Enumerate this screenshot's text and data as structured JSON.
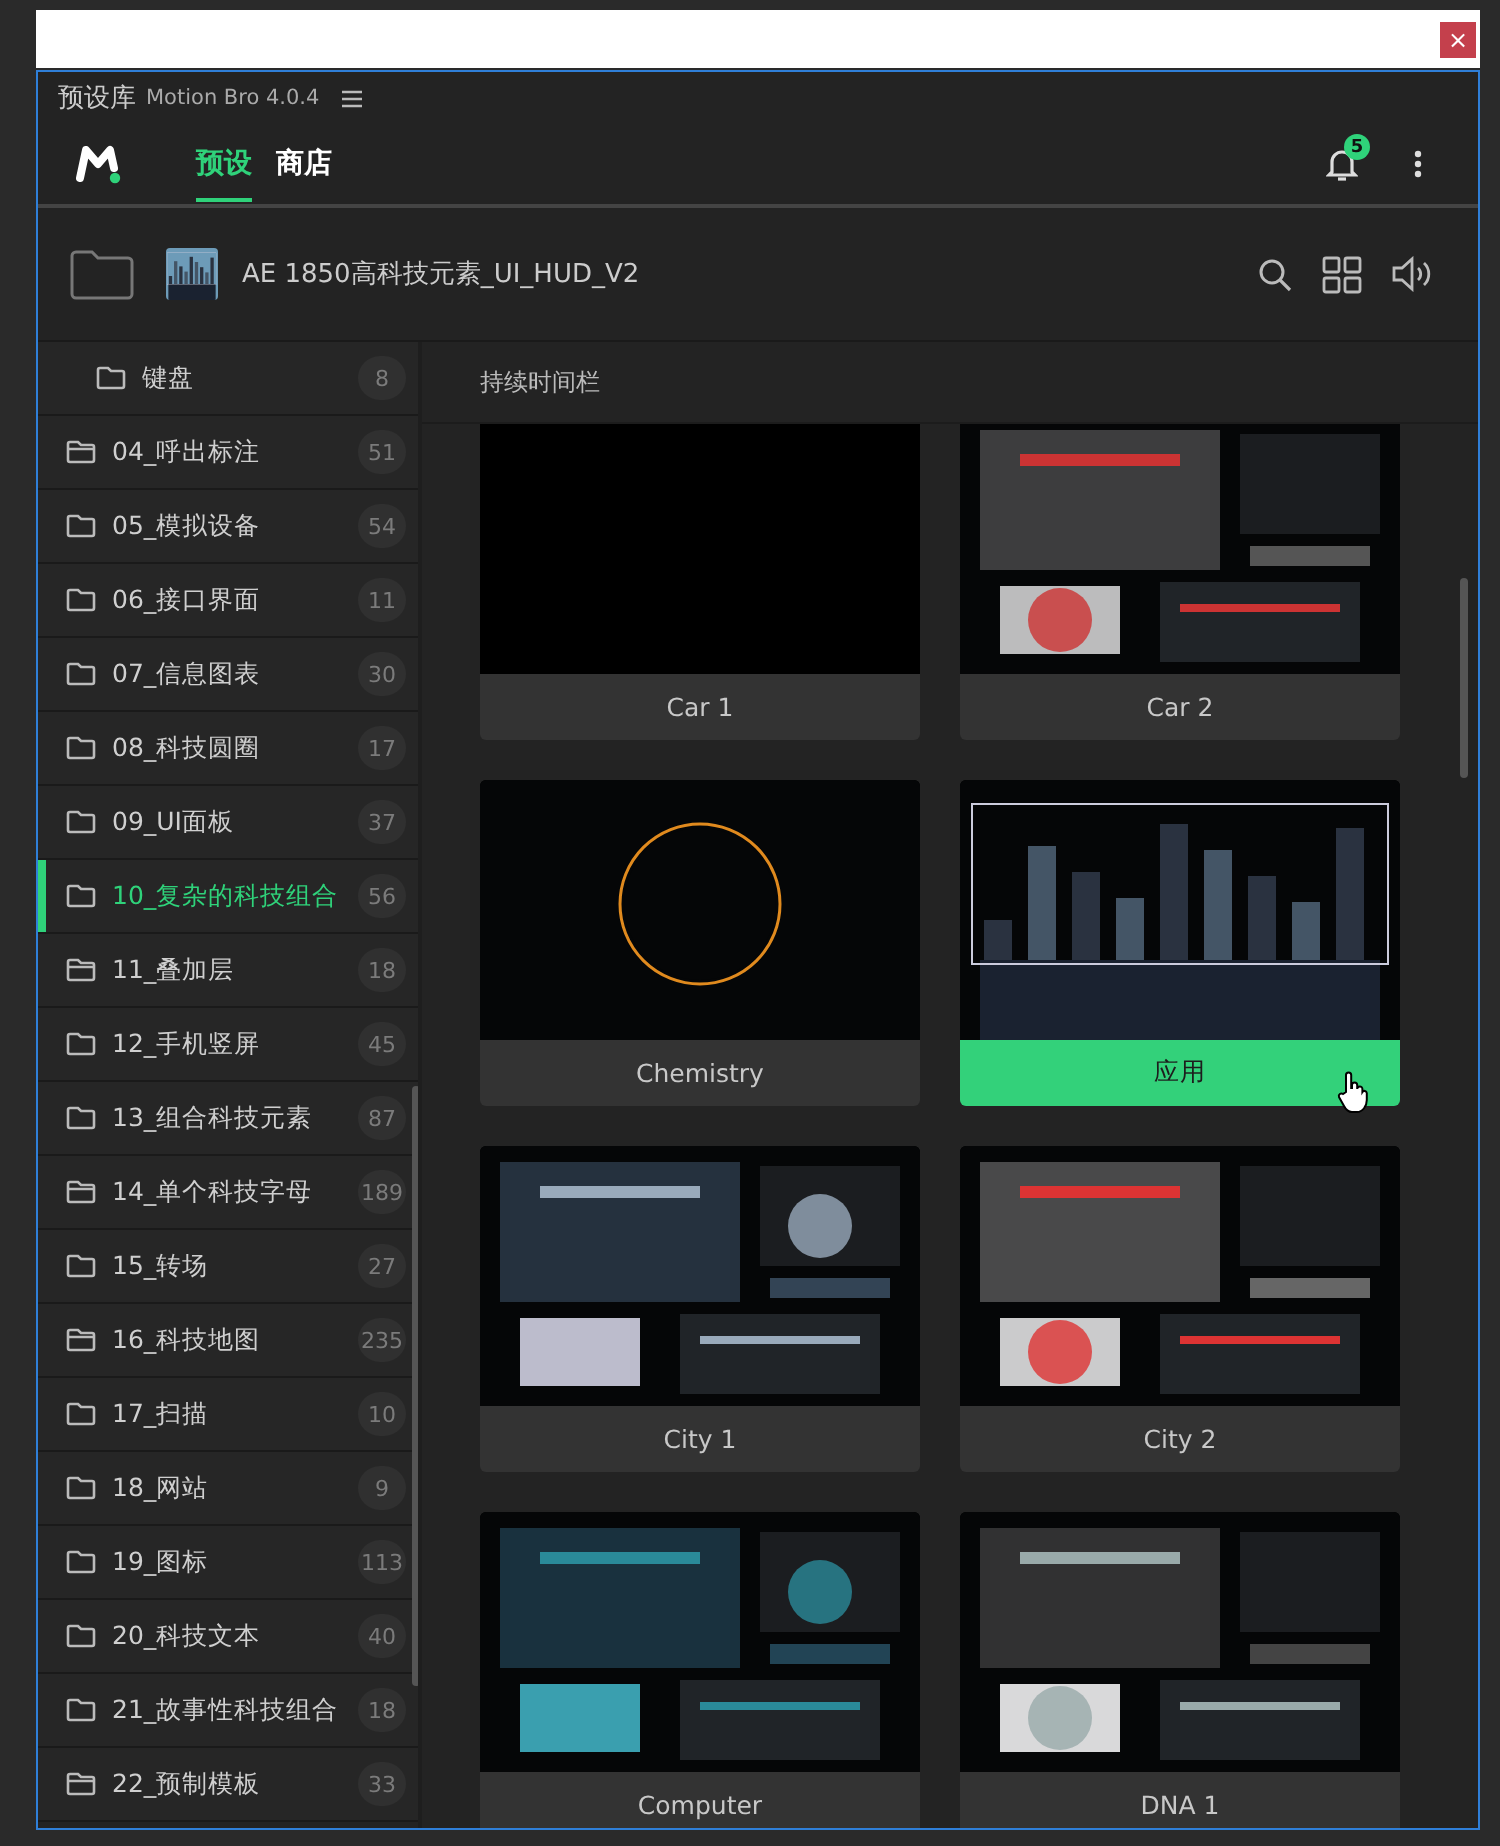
{
  "window": {
    "title": "预设库",
    "app_name": "Motion Bro 4.0.4",
    "close": "×"
  },
  "nav": {
    "tabs": [
      {
        "label": "预设",
        "selected": true
      },
      {
        "label": "商店",
        "selected": false
      }
    ],
    "notifications": "5"
  },
  "pack": {
    "title": "AE 1850高科技元素_UI_HUD_V2"
  },
  "sidebar": {
    "items": [
      {
        "children": [
          {
            "label": "键盘",
            "count": "8",
            "kind": "plain",
            "selected": false
          }
        ]
      },
      {
        "label": "04_呼出标注",
        "count": "51",
        "kind": "stack",
        "selected": false
      },
      {
        "label": "05_模拟设备",
        "count": "54",
        "kind": "plain",
        "selected": false
      },
      {
        "label": "06_接口界面",
        "count": "11",
        "kind": "plain",
        "selected": false
      },
      {
        "label": "07_信息图表",
        "count": "30",
        "kind": "plain",
        "selected": false
      },
      {
        "label": "08_科技圆圈",
        "count": "17",
        "kind": "plain",
        "selected": false
      },
      {
        "label": "09_UI面板",
        "count": "37",
        "kind": "plain",
        "selected": false
      },
      {
        "label": "10_复杂的科技组合",
        "count": "56",
        "kind": "plain",
        "selected": true
      },
      {
        "label": "11_叠加层",
        "count": "18",
        "kind": "stack",
        "selected": false
      },
      {
        "label": "12_手机竖屏",
        "count": "45",
        "kind": "plain",
        "selected": false
      },
      {
        "label": "13_组合科技元素",
        "count": "87",
        "kind": "plain",
        "selected": false
      },
      {
        "label": "14_单个科技字母",
        "count": "189",
        "kind": "stack",
        "selected": false
      },
      {
        "label": "15_转场",
        "count": "27",
        "kind": "plain",
        "selected": false
      },
      {
        "label": "16_科技地图",
        "count": "235",
        "kind": "stack",
        "selected": false
      },
      {
        "label": "17_扫描",
        "count": "10",
        "kind": "plain",
        "selected": false
      },
      {
        "label": "18_网站",
        "count": "9",
        "kind": "plain",
        "selected": false
      },
      {
        "label": "19_图标",
        "count": "113",
        "kind": "plain",
        "selected": false
      },
      {
        "label": "20_科技文本",
        "count": "40",
        "kind": "plain",
        "selected": false
      },
      {
        "label": "21_故事性科技组合",
        "count": "18",
        "kind": "plain",
        "selected": false
      },
      {
        "label": "22_预制模板",
        "count": "33",
        "kind": "stack",
        "selected": false
      }
    ]
  },
  "content": {
    "section_title": "持续时间栏",
    "presets": [
      {
        "label": "Car 1",
        "kind": "blank",
        "hovered": false
      },
      {
        "label": "Car 2",
        "kind": "picture",
        "hovered": false
      },
      {
        "label": "Chemistry",
        "kind": "picture",
        "hovered": false
      },
      {
        "label": "应用",
        "kind": "picture",
        "hovered": true
      },
      {
        "label": "City 1",
        "kind": "picture",
        "hovered": false
      },
      {
        "label": "City 2",
        "kind": "picture",
        "hovered": false
      },
      {
        "label": "Computer",
        "kind": "picture",
        "hovered": false
      },
      {
        "label": "DNA 1",
        "kind": "picture",
        "hovered": false
      }
    ]
  }
}
